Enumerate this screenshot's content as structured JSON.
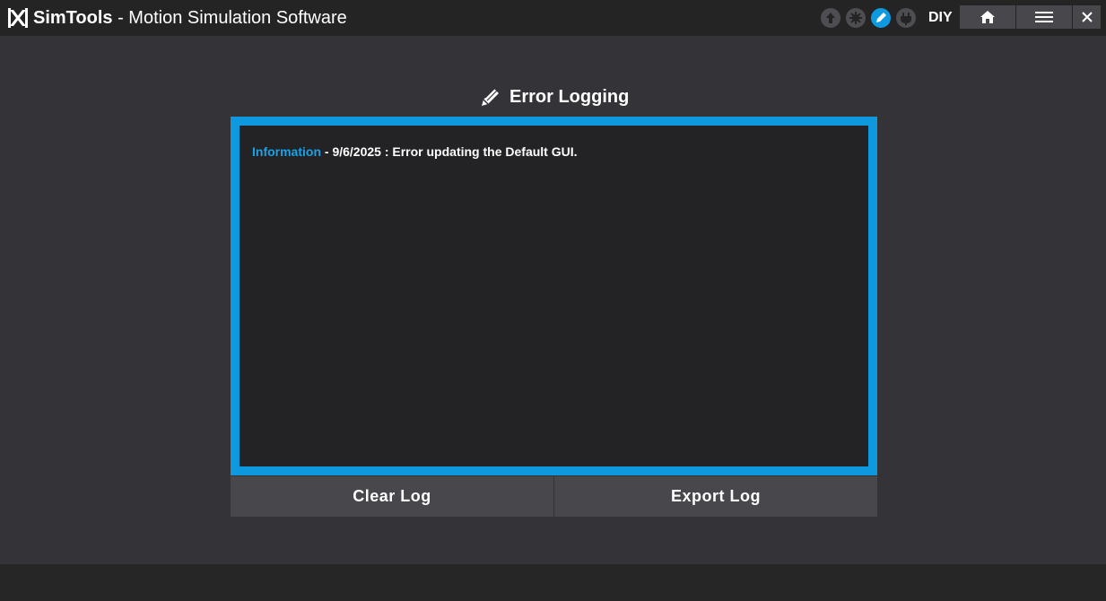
{
  "app": {
    "title": "SimTools",
    "subtitle": "- Motion Simulation Software",
    "mode": "DIY"
  },
  "status_icons": [
    {
      "name": "upload-icon",
      "active": false
    },
    {
      "name": "plugin-icon",
      "active": false
    },
    {
      "name": "edit-icon",
      "active": true
    },
    {
      "name": "power-icon",
      "active": false
    }
  ],
  "toolbar": {
    "home_icon": "home-icon",
    "menu_icon": "hamburger-menu-icon",
    "close_icon": "close-icon"
  },
  "section": {
    "title": "Error Logging",
    "icon": "pencil-icon"
  },
  "log": {
    "entries": [
      {
        "level": "Information",
        "message": " - 9/6/2025 : Error updating the Default GUI."
      }
    ]
  },
  "actions": {
    "clear_label": "Clear Log",
    "export_label": "Export Log"
  },
  "colors": {
    "accent": "#0e98de",
    "background": "#333338",
    "titlebar": "#242424",
    "button": "#47474c"
  }
}
